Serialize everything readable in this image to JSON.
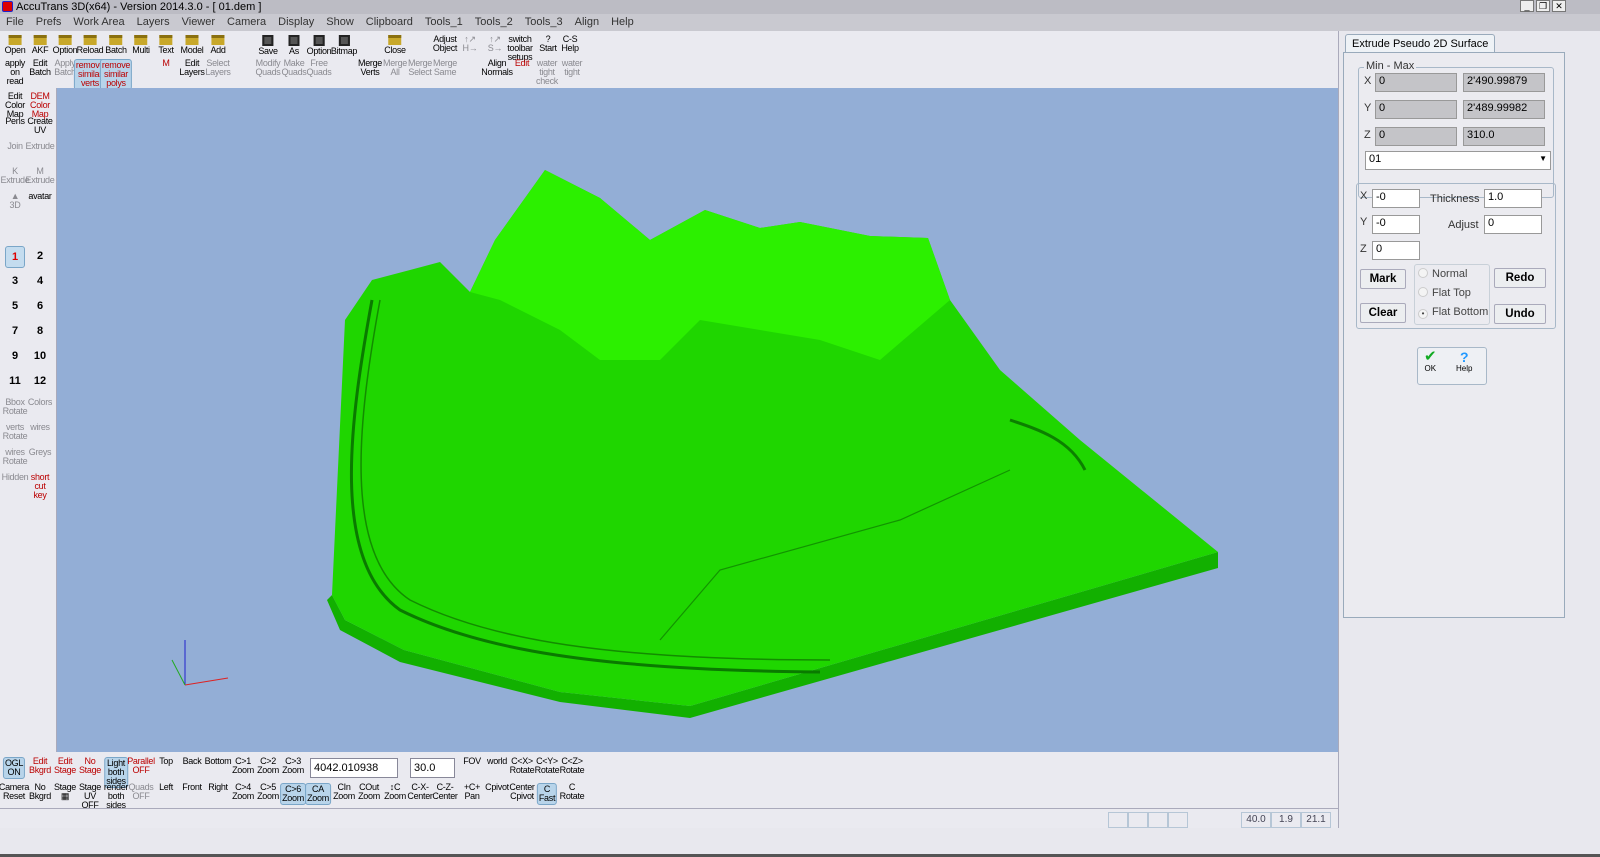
{
  "window": {
    "title": "AccuTrans 3D(x64) - Version 2014.3.0 - [ 01.dem ]",
    "controls": [
      "_",
      "❐",
      "✕"
    ]
  },
  "menu": [
    "File",
    "Prefs",
    "Work Area",
    "Layers",
    "Viewer",
    "Camera",
    "Display",
    "Show",
    "Clipboard",
    "Tools_1",
    "Tools_2",
    "Tools_3",
    "Align",
    "Help"
  ],
  "toolbar": {
    "row1": [
      [
        "Open",
        "folder",
        ""
      ],
      [
        "AKF",
        "folder",
        ""
      ],
      [
        "Option",
        "folder",
        ""
      ],
      [
        "Reload",
        "folder",
        ""
      ],
      [
        "Batch",
        "folder",
        ""
      ],
      [
        "Multi",
        "folder",
        ""
      ],
      [
        "Text",
        "folder",
        ""
      ],
      [
        "Model",
        "folder",
        ""
      ],
      [
        "Add",
        "folder",
        ""
      ],
      [
        "Save",
        "disk",
        ""
      ],
      [
        "As",
        "disk",
        ""
      ],
      [
        "Option",
        "disk",
        ""
      ],
      [
        "Bitmap",
        "disk",
        ""
      ],
      [
        "Close",
        "folder",
        ""
      ],
      [
        "Adjust\nObject",
        "",
        ""
      ],
      [
        "↑↗\nH→",
        "",
        "dis"
      ],
      [
        "↑↗\nS→",
        "",
        "dis"
      ],
      [
        "switch\ntoolbar\nsetups",
        "",
        ""
      ],
      [
        "?\nStart",
        "",
        ""
      ],
      [
        "C-S\nHelp",
        "",
        ""
      ]
    ],
    "row2": [
      [
        "apply\non\nread",
        "",
        ""
      ],
      [
        "Edit\nBatch",
        "",
        ""
      ],
      [
        "Apply\nBatch",
        "",
        "dis"
      ],
      [
        "remove\nsimilar\nverts",
        "",
        "act red"
      ],
      [
        "remove\nsimilar\npolys",
        "",
        "act red"
      ],
      [
        "M",
        "",
        "red"
      ],
      [
        "Edit\nLayers",
        "",
        ""
      ],
      [
        "Select\nLayers",
        "",
        "dis"
      ],
      [
        "Modify\nQuads",
        "",
        "dis"
      ],
      [
        "Make\nQuads",
        "",
        "dis"
      ],
      [
        "Free\nQuads",
        "",
        "dis"
      ],
      [
        "Merge\nVerts",
        "",
        ""
      ],
      [
        "Merge\nAll",
        "",
        "dis"
      ],
      [
        "Merge\nSelect",
        "",
        "dis"
      ],
      [
        "Merge\nSame",
        "",
        "dis"
      ],
      [
        "Align\nNormals",
        "",
        ""
      ],
      [
        "Edit",
        "",
        "red"
      ],
      [
        "water\ntight\ncheck",
        "",
        "dis"
      ],
      [
        "water\ntight",
        "",
        "dis"
      ]
    ]
  },
  "left_panel": {
    "tools": [
      [
        "Edit\nColor\nMap",
        ""
      ],
      [
        "DEM\nColor\nMap",
        "red"
      ],
      [
        "Pens",
        ""
      ],
      [
        "Create\nUV",
        ""
      ],
      [
        "Join",
        "dis"
      ],
      [
        "Extrude",
        "dis"
      ],
      [
        "K\nExtrude",
        "dis"
      ],
      [
        "M\nExtrude",
        "dis"
      ],
      [
        "▲\n3D",
        "dis"
      ],
      [
        "avatar",
        ""
      ]
    ],
    "layers": [
      "1",
      "2",
      "3",
      "4",
      "5",
      "6",
      "7",
      "8",
      "9",
      "10",
      "11",
      "12"
    ],
    "active_layer": "1",
    "view_tools": [
      [
        "Bbox\nRotate",
        "dis"
      ],
      [
        "Colors",
        "dis"
      ],
      [
        "verts\nRotate",
        "dis"
      ],
      [
        "wires",
        "dis"
      ],
      [
        "wires\nRotate",
        "dis"
      ],
      [
        "Greys",
        "dis"
      ],
      [
        "Hidden",
        "dis"
      ],
      [
        "short\ncut\nkey",
        "red"
      ]
    ]
  },
  "bottom_toolbar": {
    "row1": [
      [
        "OGL\nON",
        "act"
      ],
      [
        "Edit\nBkgrd",
        "red"
      ],
      [
        "Edit\nStage",
        "red"
      ],
      [
        "No\nStage",
        "red"
      ],
      [
        "Light\nboth\nsides",
        "act"
      ],
      [
        "Parallel\nOFF",
        "red"
      ],
      [
        "Top",
        ""
      ],
      [
        "Back",
        ""
      ],
      [
        "Bottom",
        ""
      ],
      [
        "C>1\nZoom",
        ""
      ],
      [
        "C>2\nZoom",
        ""
      ],
      [
        "C>3\nZoom",
        ""
      ],
      [
        "FOV",
        ""
      ],
      [
        "world",
        ""
      ],
      [
        "C<X>\nRotate",
        ""
      ],
      [
        "C<Y>\nRotate",
        ""
      ],
      [
        "C<Z>\nRotate",
        ""
      ]
    ],
    "row2": [
      [
        "Camera\nReset",
        ""
      ],
      [
        "No\nBkgrd",
        ""
      ],
      [
        "Stage\n▦",
        ""
      ],
      [
        "Stage\nUV\nOFF",
        ""
      ],
      [
        "render\nboth\nsides",
        ""
      ],
      [
        "Quads\nOFF",
        "dis"
      ],
      [
        "Left",
        ""
      ],
      [
        "Front",
        ""
      ],
      [
        "Right",
        ""
      ],
      [
        "C>4\nZoom",
        ""
      ],
      [
        "C>5\nZoom",
        ""
      ],
      [
        "C>6\nZoom",
        "act"
      ],
      [
        "CA\nZoom",
        "act"
      ],
      [
        "CIn\nZoom",
        ""
      ],
      [
        "COut\nZoom",
        ""
      ],
      [
        "↕C\nZoom",
        ""
      ],
      [
        "C-X-\nCenter",
        ""
      ],
      [
        "C-Z-\nCenter",
        ""
      ],
      [
        "+C+\nPan",
        ""
      ],
      [
        "Cpivot",
        ""
      ],
      [
        "Center\nCpivot",
        ""
      ],
      [
        "C\nFast",
        "act"
      ],
      [
        "C\nRotate",
        ""
      ]
    ],
    "distance_value": "4042.010938",
    "fov_value": "30.0"
  },
  "status": {
    "cells": [
      "",
      "",
      "",
      "",
      "40.0",
      "1.9",
      "21.1"
    ]
  },
  "panel": {
    "tab": "Extrude Pseudo 2D Surface",
    "minmax_label": "Min - Max",
    "rows": [
      {
        "axis": "X",
        "min": "0",
        "max": "2'490.99879"
      },
      {
        "axis": "Y",
        "min": "0",
        "max": "2'489.99982"
      },
      {
        "axis": "Z",
        "min": "0",
        "max": "310.0"
      }
    ],
    "select_value": "01",
    "x_label": "X",
    "x_value": "-0",
    "y_label": "Y",
    "y_value": "-0",
    "z_label": "Z",
    "z_value": "0",
    "thickness_label": "Thickness",
    "thickness_value": "1.0",
    "adjust_label": "Adjust",
    "adjust_value": "0",
    "mark": "Mark",
    "clear": "Clear",
    "redo": "Redo",
    "undo": "Undo",
    "radios": [
      "Normal",
      "Flat Top",
      "Flat Bottom"
    ],
    "radio_selected": "Flat Bottom",
    "ok": "OK",
    "help": "Help"
  },
  "colors": {
    "viewport": "#93aed6",
    "terrain": "#22dd00",
    "terrain_side": "#11a800",
    "accent": "#b8d4ea"
  }
}
